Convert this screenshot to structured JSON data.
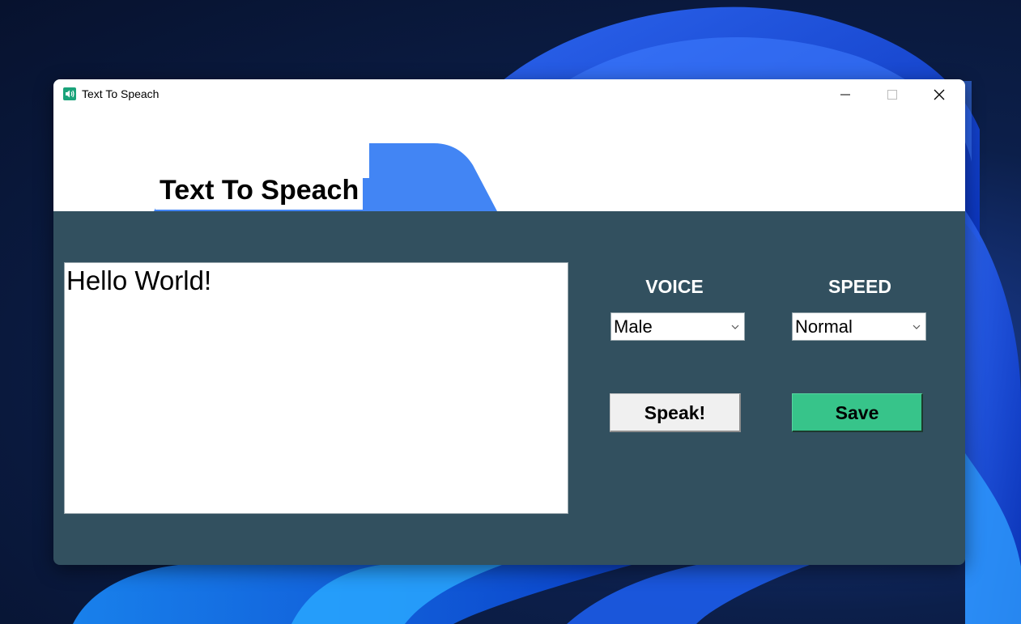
{
  "window": {
    "title": "Text To Speach",
    "icon": "speaker-icon",
    "controls": [
      "minimize-icon",
      "maximize-icon",
      "close-icon"
    ]
  },
  "header": {
    "title": "Text To Speach"
  },
  "textbox": {
    "value": "Hello World!"
  },
  "voice": {
    "label": "VOICE",
    "selected": "Male"
  },
  "speed": {
    "label": "SPEED",
    "selected": "Normal"
  },
  "buttons": {
    "speak": "Speak!",
    "save": "Save"
  },
  "colors": {
    "panel_bg": "#32505f",
    "header_accent": "#4285f4",
    "save_button": "#37c48a",
    "speak_button": "#f0f0f0"
  }
}
